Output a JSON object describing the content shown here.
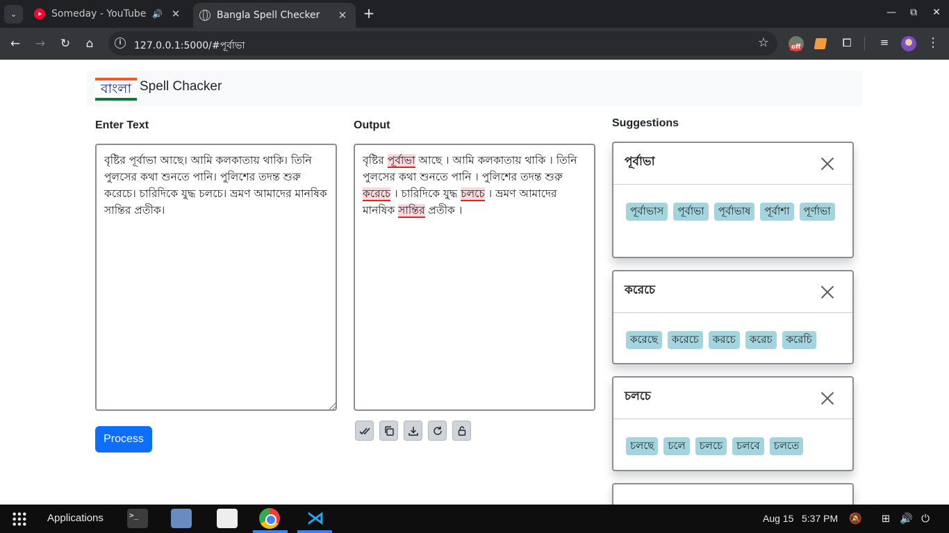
{
  "browser": {
    "tabs": [
      {
        "title": "Someday - YouTube M",
        "icon": "youtube-icon",
        "audio": true,
        "active": false
      },
      {
        "title": "Bangla Spell Checker",
        "icon": "globe-icon",
        "active": true
      }
    ],
    "url": "127.0.0.1:5000/#পূর্বাভা"
  },
  "app": {
    "brand_logo_text": "বাংলা",
    "brand_name": "Spell Chacker",
    "input_label": "Enter Text",
    "input_text": "বৃষ্টির পূর্বাভা আছে। আমি কলকাতায় থাকি। তিনি পুলসের কথা শুনতে পানি। পুলিশের তদন্ত শুরু করেচে। চারিদিকে যুদ্ধ চলচে। ভ্রমণ আমাদের মানষিক সান্তির প্রতীক।",
    "output_label": "Output",
    "output_segments": [
      {
        "text": "বৃষ্টির ",
        "error": false
      },
      {
        "text": "পূর্বাভা",
        "error": true
      },
      {
        "text": " আছে । আমি কলকাতায় থাকি । তিনি পুলসের কথা শুনতে পানি । পুলিশের তদন্ত শুরু ",
        "error": false
      },
      {
        "text": "করেচে",
        "error": true
      },
      {
        "text": " । চারিদিকে যুদ্ধ ",
        "error": false
      },
      {
        "text": "চলচে",
        "error": true
      },
      {
        "text": " । ভ্রমণ আমাদের মানষিক ",
        "error": false
      },
      {
        "text": "সান্তির",
        "error": true
      },
      {
        "text": " প্রতীক ।",
        "error": false
      }
    ],
    "process_button": "Process",
    "output_tools": [
      "check-all-icon",
      "copy-icon",
      "download-icon",
      "refresh-icon",
      "lock-icon"
    ],
    "suggestions_label": "Suggestions",
    "suggestions": [
      {
        "word": "পূর্বাভা",
        "options": [
          "পূর্বাভাস",
          "পূর্বাভা",
          "পূর্বাভাষ",
          "পূর্বাশা",
          "পূর্ণাভা"
        ]
      },
      {
        "word": "করেচে",
        "options": [
          "করেছে",
          "করেচে",
          "করচে",
          "করেচ",
          "করেচি"
        ]
      },
      {
        "word": "চলচে",
        "options": [
          "চলছে",
          "চলে",
          "চলচে",
          "চলবে",
          "চলতে"
        ]
      }
    ]
  },
  "taskbar": {
    "apps_label": "Applications",
    "date": "Aug 15",
    "time": "5:37 PM"
  },
  "colors": {
    "primary": "#0d6efd",
    "error_bg": "#fbd8dc",
    "error_underline": "#e02424",
    "chip_bg": "#a4d4de"
  }
}
